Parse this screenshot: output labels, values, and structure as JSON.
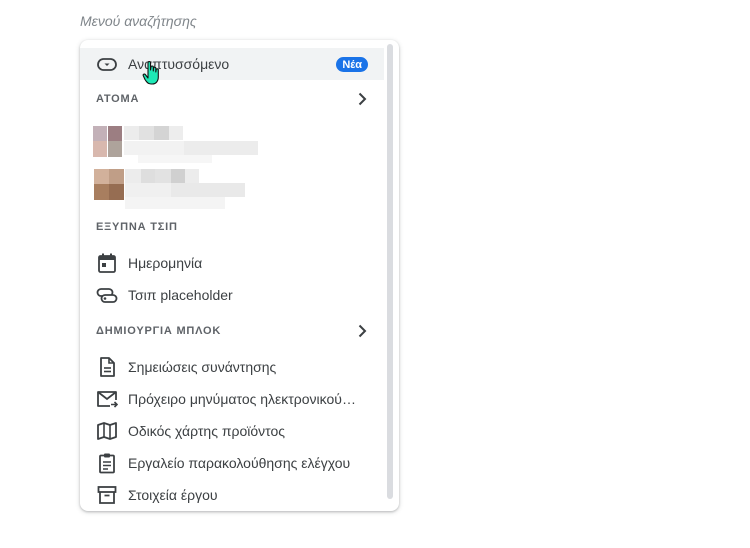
{
  "caption": "Μενού αναζήτησης",
  "rows_top": {
    "expandable": {
      "label": "Αναπτυσσόμενο",
      "badge": "Νέα",
      "icon": "dropdown-icon"
    }
  },
  "people_section": {
    "title": "ΑΤΟΜΑ",
    "icon": "chevron-right-icon"
  },
  "smart_chips_section": {
    "title": "ΕΞΥΠΝΑ ΤΣΙΠ",
    "items": [
      {
        "label": "Ημερομηνία",
        "icon": "calendar-icon"
      },
      {
        "label": "Τσιπ placeholder",
        "icon": "placeholder-chip-icon"
      }
    ]
  },
  "building_blocks_section": {
    "title": "ΔΗΜΙΟΥΡΓΙΑ ΜΠΛΟΚ",
    "icon": "chevron-right-icon",
    "items": [
      {
        "label": "Σημειώσεις συνάντησης",
        "icon": "document-icon"
      },
      {
        "label": "Πρόχειρο μηνύματος ηλεκτρονικού ταχυδρομείου",
        "icon": "email-draft-icon"
      },
      {
        "label": "Οδικός χάρτης προϊόντος",
        "icon": "map-icon"
      },
      {
        "label": "Εργαλείο παρακολούθησης ελέγχου",
        "icon": "clipboard-icon"
      },
      {
        "label": "Στοιχεία έργου",
        "icon": "archive-icon"
      }
    ]
  },
  "colors": {
    "badge": "#1a73e8",
    "hover": "#f1f3f4",
    "icon": "#3c4043",
    "cursor": "#1de9b6"
  }
}
